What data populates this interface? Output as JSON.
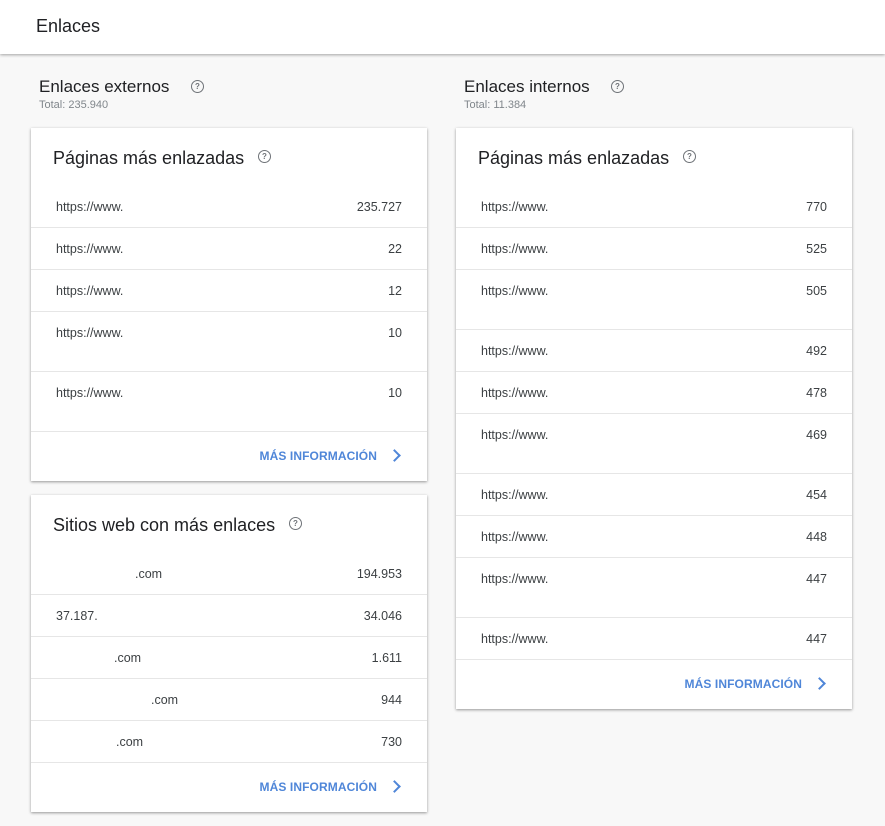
{
  "header": {
    "title": "Enlaces"
  },
  "external": {
    "title": "Enlaces externos",
    "total": "Total: 235.940",
    "top_pages": {
      "title": "Páginas más enlazadas",
      "rows": [
        {
          "label": "https://www.",
          "value": "235.727"
        },
        {
          "label": "https://www.",
          "value": "22"
        },
        {
          "label": "https://www.",
          "value": "12"
        },
        {
          "label": "https://www.",
          "value": "10"
        },
        {
          "label": "https://www.",
          "value": "10"
        }
      ],
      "more": "MÁS INFORMACIÓN"
    },
    "top_sites": {
      "title": "Sitios web con más enlaces",
      "rows": [
        {
          "label": ".com",
          "value": "194.953"
        },
        {
          "label": "37.187.",
          "value": "34.046"
        },
        {
          "label": ".com",
          "value": "1.611"
        },
        {
          "label": ".com",
          "value": "944"
        },
        {
          "label": ".com",
          "value": "730"
        }
      ],
      "more": "MÁS INFORMACIÓN"
    }
  },
  "internal": {
    "title": "Enlaces internos",
    "total": "Total: 11.384",
    "top_pages": {
      "title": "Páginas más enlazadas",
      "rows": [
        {
          "label": "https://www.",
          "value": "770"
        },
        {
          "label": "https://www.",
          "value": "525"
        },
        {
          "label": "https://www.",
          "value": "505"
        },
        {
          "label": "https://www.",
          "value": "492"
        },
        {
          "label": "https://www.",
          "value": "478"
        },
        {
          "label": "https://www.",
          "value": "469"
        },
        {
          "label": "https://www.",
          "value": "454"
        },
        {
          "label": "https://www.",
          "value": "448"
        },
        {
          "label": "https://www.",
          "value": "447"
        },
        {
          "label": "https://www.",
          "value": "447"
        }
      ],
      "more": "MÁS INFORMACIÓN"
    }
  },
  "icons": {
    "help": "help-circle-icon",
    "more": "chevron-right-icon"
  },
  "colors": {
    "link": "#4f86d8",
    "background": "#f8f8f8",
    "card": "#ffffff"
  }
}
